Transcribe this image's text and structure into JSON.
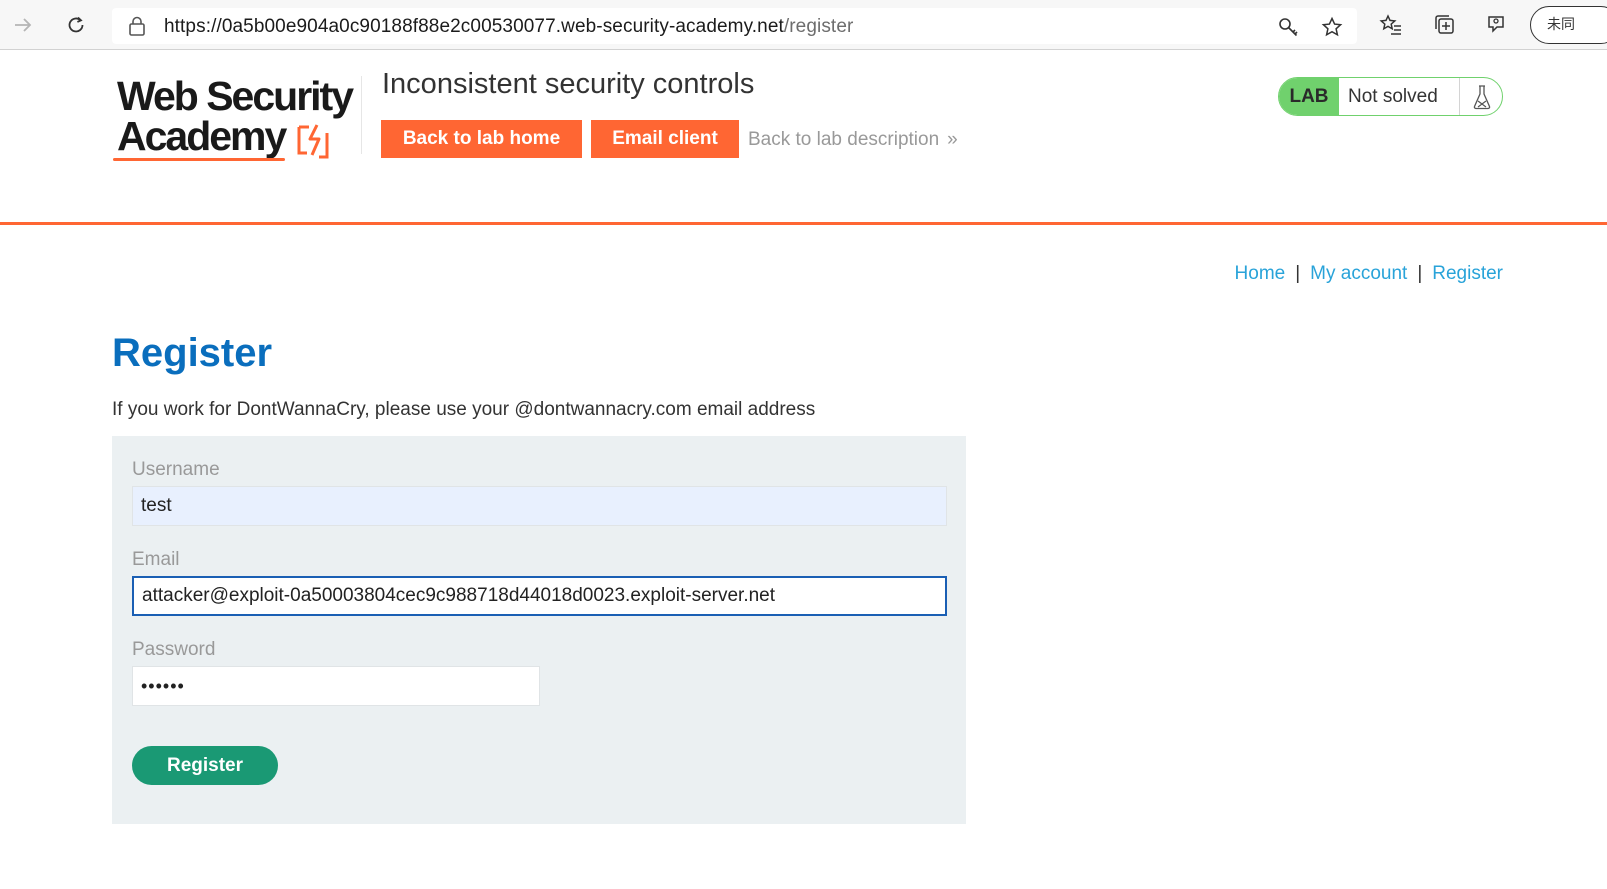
{
  "browser": {
    "url_base": "https://0a5b00e904a0c90188f88e2c00530077.web-security-academy.net",
    "url_path": "/register",
    "profile_label": "未同"
  },
  "lab": {
    "logo_line1": "Web Security",
    "logo_line2": "Academy",
    "title": "Inconsistent security controls",
    "back_to_lab_home": "Back to lab home",
    "email_client": "Email client",
    "back_to_description": "Back to lab description",
    "back_to_description_chevron": "»",
    "status_badge": "LAB",
    "status_text": "Not solved",
    "accent_color": "#ff6633",
    "status_color": "#70d16d"
  },
  "nav": {
    "home": "Home",
    "my_account": "My account",
    "register": "Register",
    "separator": "|"
  },
  "page": {
    "title": "Register",
    "intro": "If you work for DontWannaCry, please use your @dontwannacry.com email address"
  },
  "form": {
    "username_label": "Username",
    "username_value": "test",
    "email_label": "Email",
    "email_value": "attacker@exploit-0a50003804cec9c988718d44018d0023.exploit-server.net",
    "password_label": "Password",
    "password_value": "••••••",
    "submit_label": "Register",
    "submit_color": "#1a9974",
    "title_color": "#0a6ebd"
  }
}
